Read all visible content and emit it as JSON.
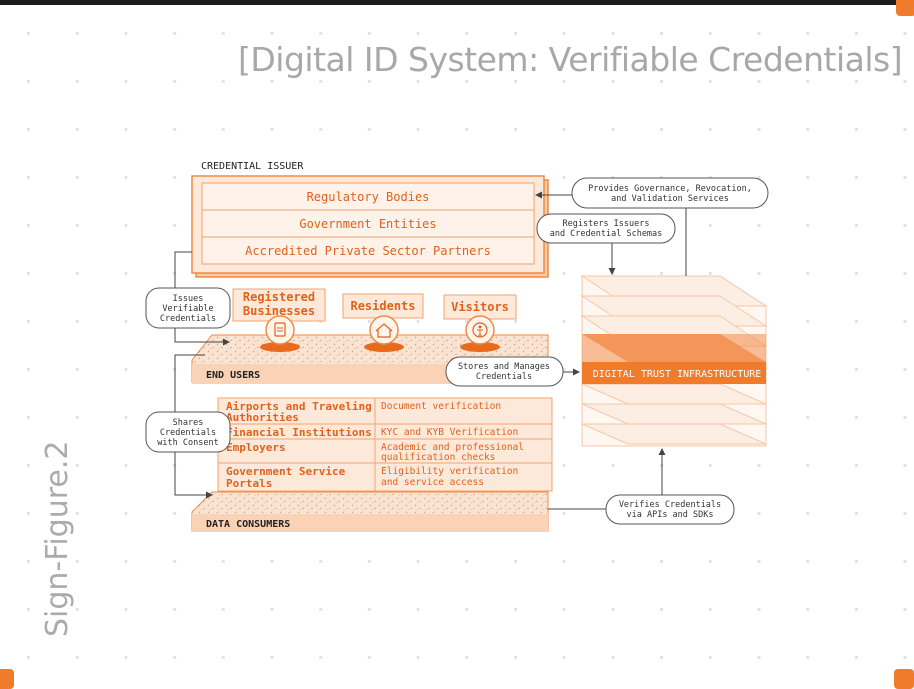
{
  "page": {
    "title": "[Digital ID System: Verifiable Credentials]",
    "side_label": "Sign-Figure.2"
  },
  "diagram": {
    "credential_issuer": {
      "heading": "CREDENTIAL ISSUER",
      "rows": [
        "Regulatory Bodies",
        "Government Entities",
        "Accredited Private Sector Partners"
      ]
    },
    "end_users": {
      "heading": "END USERS",
      "groups": [
        "Registered Businesses",
        "Residents",
        "Visitors"
      ],
      "group_icons": [
        "clipboard-icon",
        "home-icon",
        "person-icon"
      ]
    },
    "data_consumers": {
      "heading": "DATA CONSUMERS",
      "rows": [
        {
          "name": "Airports and Traveling Authorities",
          "use": "Document verification"
        },
        {
          "name": "Financial Institutions",
          "use": "KYC and KYB Verification"
        },
        {
          "name": "Employers",
          "use": "Academic and professional qualification checks"
        },
        {
          "name": "Government Service Portals",
          "use": "Eligibility verification and service access"
        }
      ]
    },
    "infrastructure": {
      "label": "DIGITAL TRUST INFRASTRUCTURE"
    },
    "callouts": {
      "governance": "Provides Governance, Revocation, and Validation Services",
      "registers": "Registers Issuers and Credential Schemas",
      "issues": "Issues Verifiable Credentials",
      "stores": "Stores and Manages Credentials",
      "shares": "Shares Credentials with Consent",
      "verifies": "Verifies Credentials via APIs and SDKs"
    },
    "colors": {
      "accent": "#f07b2a",
      "accent_text": "#e0621c",
      "fill_light": "#fde9da",
      "fill_mid": "#f9c9a6",
      "frame": "#f3a36f",
      "callout_border": "#555555",
      "ink": "#222222",
      "muted_title": "#a8a8a8"
    }
  }
}
